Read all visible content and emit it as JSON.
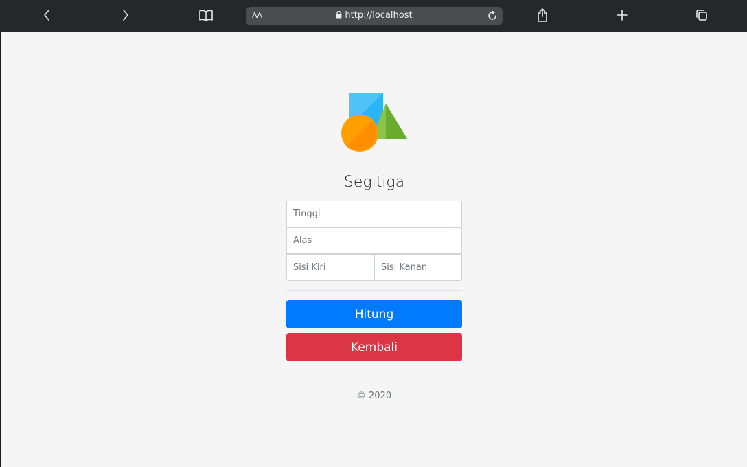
{
  "browser": {
    "url": "http://localhost",
    "text_size_label": "AA",
    "icons": [
      "back-icon",
      "forward-icon",
      "bookmarks-icon",
      "lock-icon",
      "reload-icon",
      "share-icon",
      "new-tab-icon",
      "tabs-icon"
    ]
  },
  "app": {
    "title": "Segitiga",
    "logo_icon": "shapes-logo-icon",
    "fields": {
      "tinggi_placeholder": "Tinggi",
      "alas_placeholder": "Alas",
      "sisi_kiri_placeholder": "Sisi Kiri",
      "sisi_kanan_placeholder": "Sisi Kanan"
    },
    "buttons": {
      "hitung": "Hitung",
      "kembali": "Kembali"
    },
    "footer": "© 2020"
  },
  "colors": {
    "toolbar_bg": "#25272b",
    "page_bg": "#f5f5f5",
    "primary": "#007bff",
    "danger": "#dc3545",
    "logo_square": "#4fc3f7",
    "logo_triangle": "#7cc242",
    "logo_circle": "#ffa000"
  }
}
